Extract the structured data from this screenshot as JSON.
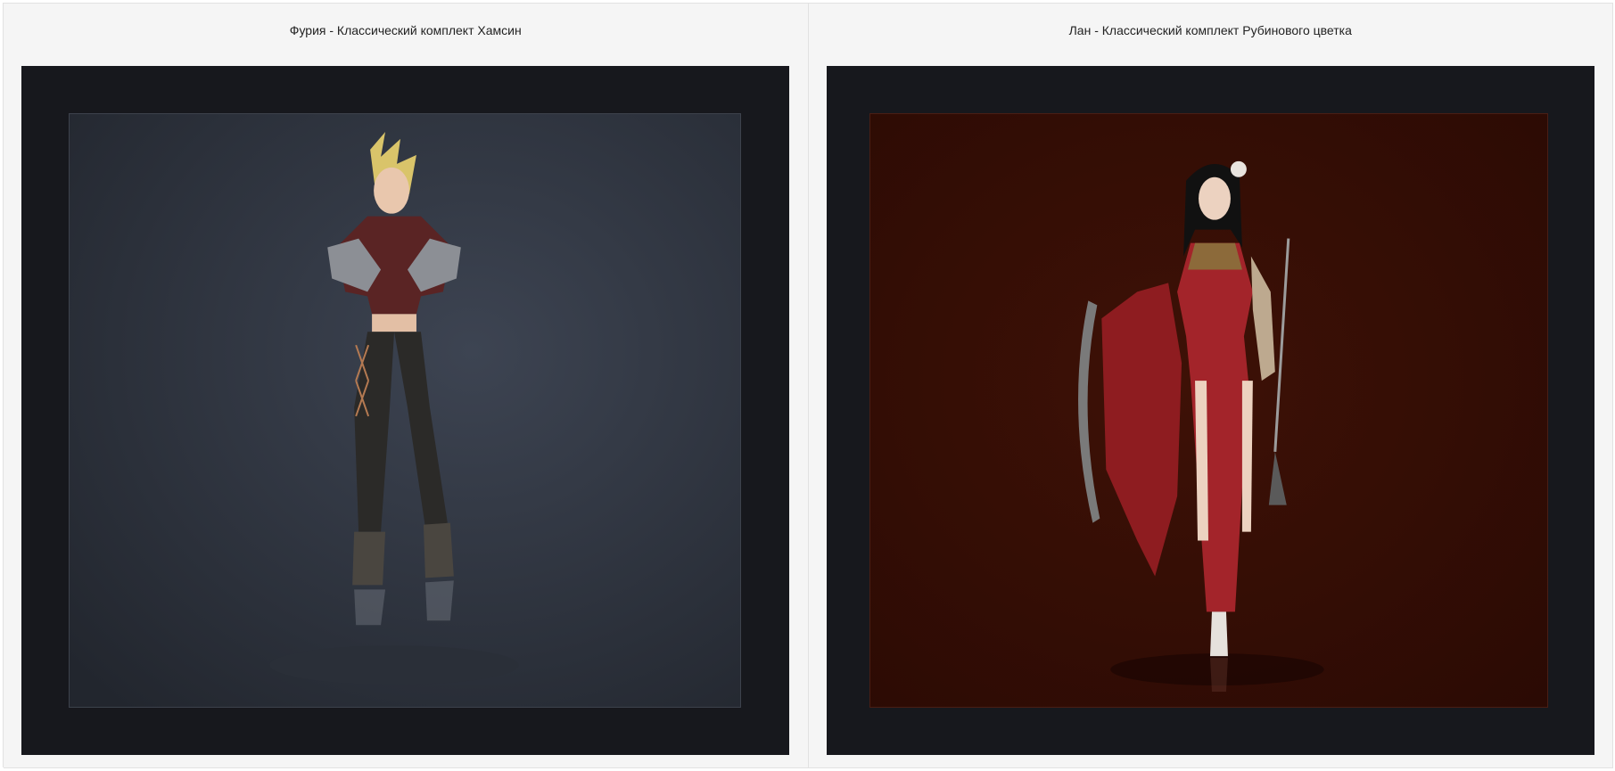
{
  "gallery": {
    "items": [
      {
        "caption": "Фурия - Классический комплект Хамсин",
        "background": "#343a46",
        "accent": "#5a2424",
        "hair": "#e8d47c"
      },
      {
        "caption": "Лан - Классический комплект Рубинового цветка",
        "background": "#360e06",
        "accent": "#a3242a",
        "hair": "#111111"
      }
    ]
  }
}
